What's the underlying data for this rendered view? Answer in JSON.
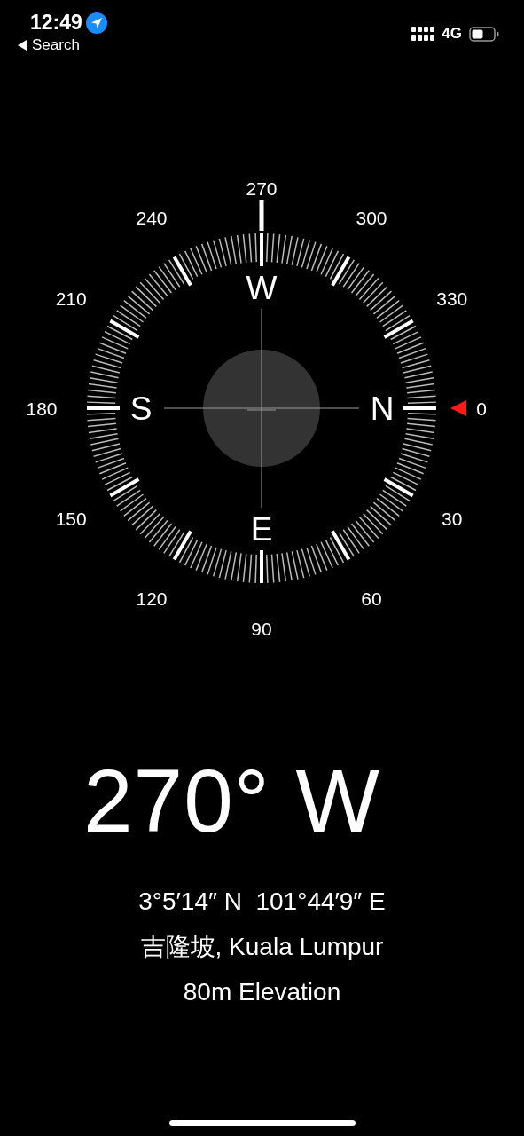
{
  "status_bar": {
    "time": "12:49",
    "back_label": "Search",
    "network": "4G"
  },
  "compass": {
    "degree_labels": [
      "0",
      "30",
      "60",
      "90",
      "120",
      "150",
      "180",
      "210",
      "240",
      "270",
      "300",
      "330"
    ],
    "cardinals": [
      "N",
      "E",
      "S",
      "W"
    ]
  },
  "heading": "270° W",
  "coordinates": "3°5′14″ N  101°44′9″ E",
  "location": "吉隆坡, Kuala Lumpur",
  "elevation": "80m Elevation"
}
